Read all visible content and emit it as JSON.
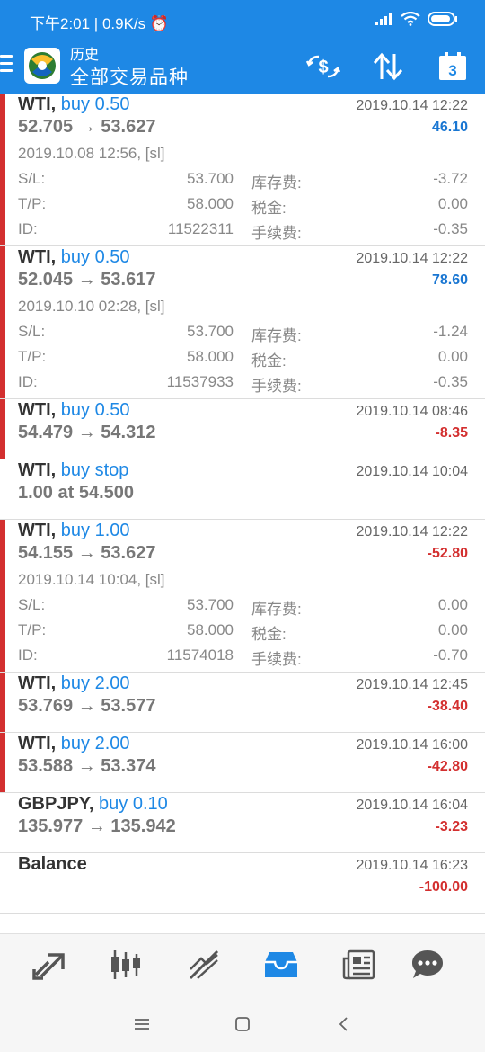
{
  "status_bar": {
    "time_speed": "下午2:01 | 0.9K/s ⏰",
    "battery_icon": "battery-icon",
    "wifi_icon": "wifi-icon",
    "signal_icon": "signal-icon"
  },
  "app_bar": {
    "title": "历史",
    "subtitle": "全部交易品种",
    "menu_icon": "menu-icon",
    "logo_icon": "metatrader-logo-icon",
    "currency_icon": "currency-exchange-icon",
    "sort_icon": "sort-icon",
    "calendar_day": "3"
  },
  "deals": [
    {
      "symbol": "WTI,",
      "kind": "buy 0.50",
      "prices": "52.705 → 53.627",
      "time": "2019.10.14 12:22",
      "profit": "46.10",
      "profit_type": "pos",
      "bar": true,
      "details": {
        "opened": "2019.10.08 12:56, [sl]",
        "sl_label": "S/L:",
        "sl": "53.700",
        "swap_label": "库存费:",
        "swap": "-3.72",
        "tp_label": "T/P:",
        "tp": "58.000",
        "tax_label": "税金:",
        "tax": "0.00",
        "id_label": "ID:",
        "id": "11522311",
        "fee_label": "手续费:",
        "fee": "-0.35"
      }
    },
    {
      "symbol": "WTI,",
      "kind": "buy 0.50",
      "prices": "52.045 → 53.617",
      "time": "2019.10.14 12:22",
      "profit": "78.60",
      "profit_type": "pos",
      "bar": true,
      "details": {
        "opened": "2019.10.10 02:28, [sl]",
        "sl_label": "S/L:",
        "sl": "53.700",
        "swap_label": "库存费:",
        "swap": "-1.24",
        "tp_label": "T/P:",
        "tp": "58.000",
        "tax_label": "税金:",
        "tax": "0.00",
        "id_label": "ID:",
        "id": "11537933",
        "fee_label": "手续费:",
        "fee": "-0.35"
      }
    },
    {
      "symbol": "WTI,",
      "kind": "buy 0.50",
      "prices": "54.479 → 54.312",
      "time": "2019.10.14 08:46",
      "profit": "-8.35",
      "profit_type": "neg",
      "bar": true
    },
    {
      "symbol": "WTI,",
      "kind": "buy stop",
      "prices": "1.00 at 54.500",
      "time": "2019.10.14 10:04",
      "profit": "",
      "profit_type": "neg",
      "bar": false
    },
    {
      "symbol": "WTI,",
      "kind": "buy 1.00",
      "prices": "54.155 → 53.627",
      "time": "2019.10.14 12:22",
      "profit": "-52.80",
      "profit_type": "neg",
      "bar": true,
      "details": {
        "opened": "2019.10.14 10:04, [sl]",
        "sl_label": "S/L:",
        "sl": "53.700",
        "swap_label": "库存费:",
        "swap": "0.00",
        "tp_label": "T/P:",
        "tp": "58.000",
        "tax_label": "税金:",
        "tax": "0.00",
        "id_label": "ID:",
        "id": "11574018",
        "fee_label": "手续费:",
        "fee": "-0.70"
      }
    },
    {
      "symbol": "WTI,",
      "kind": "buy 2.00",
      "prices": "53.769 → 53.577",
      "time": "2019.10.14 12:45",
      "profit": "-38.40",
      "profit_type": "neg",
      "bar": true
    },
    {
      "symbol": "WTI,",
      "kind": "buy 2.00",
      "prices": "53.588 → 53.374",
      "time": "2019.10.14 16:00",
      "profit": "-42.80",
      "profit_type": "neg",
      "bar": true
    },
    {
      "symbol": "GBPJPY,",
      "kind": "buy 0.10",
      "prices": "135.977 → 135.942",
      "time": "2019.10.14 16:04",
      "profit": "-3.23",
      "profit_type": "neg",
      "bar": false
    },
    {
      "symbol": "Balance",
      "kind": "",
      "prices": "",
      "time": "2019.10.14 16:23",
      "profit": "-100.00",
      "profit_type": "neg",
      "bar": false
    }
  ],
  "bottom_nav": [
    {
      "icon": "quotes-icon"
    },
    {
      "icon": "chart-icon"
    },
    {
      "icon": "trade-icon"
    },
    {
      "icon": "history-icon",
      "active": true
    },
    {
      "icon": "news-icon"
    },
    {
      "icon": "chat-icon"
    }
  ],
  "colors": {
    "accent": "#1e88e5",
    "loss": "#d32f2f",
    "profit": "#1976d2"
  }
}
